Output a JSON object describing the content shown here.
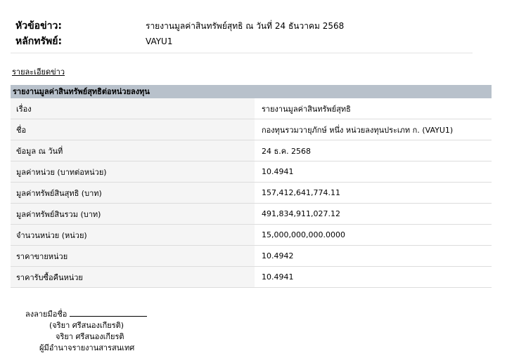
{
  "header": {
    "subject_label": "หัวข้อข่าว:",
    "subject_value": "รายงานมูลค่าสินทรัพย์สุทธิ ณ วันที่ 24 ธันวาคม 2568",
    "security_label": "หลักทรัพย์:",
    "security_value": "VAYU1"
  },
  "news_detail_link": "รายละเอียดข่าว",
  "report": {
    "title": "รายงานมูลค่าสินทรัพย์สุทธิต่อหน่วยลงทุน",
    "rows": [
      {
        "label": "เรื่อง",
        "value": "รายงานมูลค่าสินทรัพย์สุทธิ"
      },
      {
        "label": "ชื่อ",
        "value": "กองทุนรวมวายุภักษ์ หนึ่ง หน่วยลงทุนประเภท ก. (VAYU1)"
      },
      {
        "label": "ข้อมูล ณ วันที่",
        "value": "24 ธ.ค. 2568"
      },
      {
        "label": "มูลค่าหน่วย (บาทต่อหน่วย)",
        "value": "10.4941"
      },
      {
        "label": "มูลค่าทรัพย์สินสุทธิ (บาท)",
        "value": "157,412,641,774.11"
      },
      {
        "label": "มูลค่าทรัพย์สินรวม (บาท)",
        "value": "491,834,911,027.12"
      },
      {
        "label": "จำนวนหน่วย (หน่วย)",
        "value": "15,000,000,000.0000"
      },
      {
        "label": "ราคาขายหน่วย",
        "value": "10.4942"
      },
      {
        "label": "ราคารับซื้อคืนหน่วย",
        "value": "10.4941"
      }
    ]
  },
  "signature": {
    "sign_label": "ลงลายมือชื่อ",
    "name_parenthesized": "(จริยา ศรีสนองเกียรติ)",
    "name": "จริยา ศรีสนองเกียรติ",
    "position": "ผู้มีอำนาจรายงานสารสนเทศ"
  }
}
